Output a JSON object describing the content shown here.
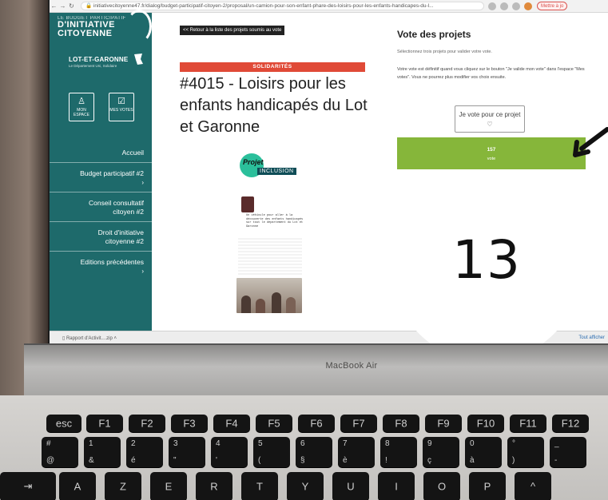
{
  "browser": {
    "url": "initiativecitoyenne47.fr/dialog/budget-participatif-citoyen-2/proposal/un-camion-pour-son-enfant-phare-des-loisirs-pour-les-enfants-handicapes-du-l...",
    "action_button": "Mettre à jo"
  },
  "sidebar": {
    "logo_line1": "LE BUDGET PARTICIPATIF",
    "logo_line2": "D'INITIATIVE",
    "logo_line3": "CITOYENNE",
    "department": "LOT-ET-GARONNE",
    "department_sub": "Le Département Uni, Solidaire",
    "btn_espace": "MON ESPACE",
    "btn_votes": "MES VOTES",
    "menu": [
      {
        "label": "Accueil"
      },
      {
        "label": "Budget participatif #2"
      },
      {
        "label": "Conseil consultatif citoyen #2"
      },
      {
        "label": "Droit d'initiative citoyenne #2"
      },
      {
        "label": "Editions précédentes"
      }
    ]
  },
  "content": {
    "back_link": "<< Retour à la liste des projets soumis au vote",
    "category": "SOLIDARITÉS",
    "title": "#4015 - Loisirs pour les enfants handicapés du Lot et Garonne",
    "poster": {
      "logo_word1": "Projet",
      "logo_word2": "INCLUSION",
      "text": "Un véhicule pour aller à la découverte des enfants handicapés sur tout le département du Lot et Garonne"
    }
  },
  "vote": {
    "title": "Vote des projets",
    "instruction": "Sélectionnez trois projets pour valider votre vote.",
    "warning": "Votre vote est définitif quand vous cliquez sur le bouton \"Je valide mon vote\" dans l'espace \"Mes votes\". Vous ne pourrez plus modifier vos choix ensuite.",
    "button_label": "Je vote pour ce projet",
    "count": "157",
    "count_label": "vote"
  },
  "status_bar": {
    "download": "Rapport d'Activit....zip",
    "show_all": "Tout afficher"
  },
  "laptop": {
    "brand": "MacBook Air"
  },
  "sticker": {
    "number": "13"
  },
  "keyboard": {
    "function_row": [
      "esc",
      "F1",
      "F2",
      "F3",
      "F4",
      "F5",
      "F6",
      "F7",
      "F8",
      "F9",
      "F10",
      "F11",
      "F12"
    ],
    "number_row": [
      {
        "top": "#",
        "bot": "@"
      },
      {
        "top": "1",
        "bot": "&"
      },
      {
        "top": "2",
        "bot": "é"
      },
      {
        "top": "3",
        "bot": "\""
      },
      {
        "top": "4",
        "bot": "'"
      },
      {
        "top": "5",
        "bot": "("
      },
      {
        "top": "6",
        "bot": "§"
      },
      {
        "top": "7",
        "bot": "è"
      },
      {
        "top": "8",
        "bot": "!"
      },
      {
        "top": "9",
        "bot": "ç"
      },
      {
        "top": "0",
        "bot": "à"
      },
      {
        "top": "°",
        "bot": ")"
      },
      {
        "top": "_",
        "bot": "-"
      }
    ],
    "letter_row": [
      "⇥",
      "A",
      "Z",
      "E",
      "R",
      "T",
      "Y",
      "U",
      "I",
      "O",
      "P",
      "^"
    ]
  }
}
